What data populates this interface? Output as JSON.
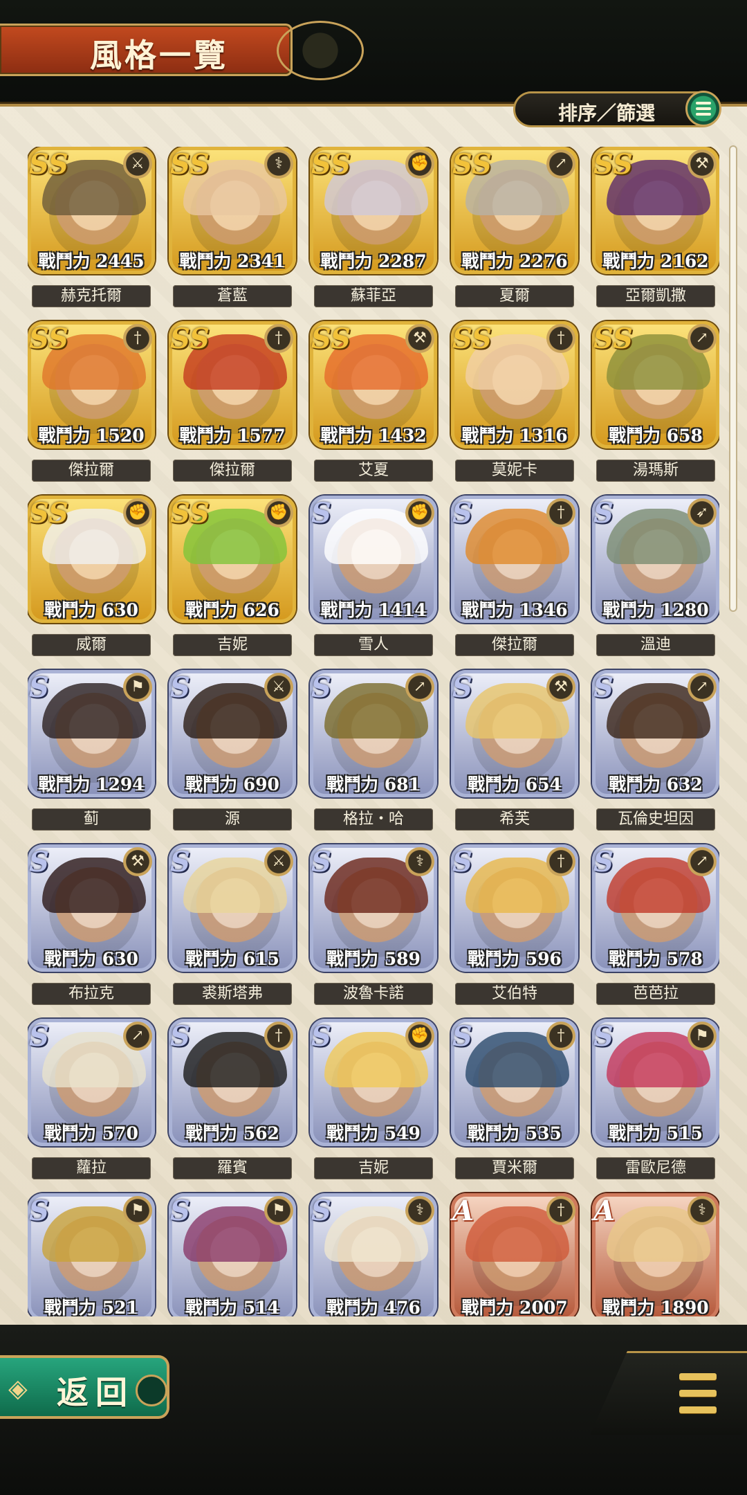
{
  "header": {
    "title": "風格一覽"
  },
  "toolbar": {
    "sort_filter_label": "排序／篩選"
  },
  "footer": {
    "back_label": "返回"
  },
  "rank_labels": {
    "ss": "SS",
    "s": "S",
    "a": "A"
  },
  "power_prefix": "戰鬥力",
  "weapon_icons": {
    "sword": "⚔",
    "axe": "⚒",
    "staff": "⚕",
    "spear": "↗",
    "bow": "➶",
    "fist": "✊",
    "dagger": "†",
    "club": "⚑"
  },
  "characters": [
    {
      "name": "赫克托爾",
      "power": "2445",
      "rank": "ss",
      "weapon": "sword"
    },
    {
      "name": "蒼藍",
      "power": "2341",
      "rank": "ss",
      "weapon": "staff"
    },
    {
      "name": "蘇菲亞",
      "power": "2287",
      "rank": "ss",
      "weapon": "fist"
    },
    {
      "name": "夏爾",
      "power": "2276",
      "rank": "ss",
      "weapon": "spear"
    },
    {
      "name": "亞爾凱撒",
      "power": "2162",
      "rank": "ss",
      "weapon": "axe"
    },
    {
      "name": "傑拉爾",
      "power": "1520",
      "rank": "ss",
      "weapon": "dagger"
    },
    {
      "name": "傑拉爾",
      "power": "1577",
      "rank": "ss",
      "weapon": "dagger"
    },
    {
      "name": "艾夏",
      "power": "1432",
      "rank": "ss",
      "weapon": "axe"
    },
    {
      "name": "莫妮卡",
      "power": "1316",
      "rank": "ss",
      "weapon": "dagger"
    },
    {
      "name": "湯瑪斯",
      "power": "658",
      "rank": "ss",
      "weapon": "spear"
    },
    {
      "name": "威爾",
      "power": "630",
      "rank": "ss",
      "weapon": "fist"
    },
    {
      "name": "吉妮",
      "power": "626",
      "rank": "ss",
      "weapon": "fist"
    },
    {
      "name": "雪人",
      "power": "1414",
      "rank": "s",
      "weapon": "fist"
    },
    {
      "name": "傑拉爾",
      "power": "1346",
      "rank": "s",
      "weapon": "dagger"
    },
    {
      "name": "溫迪",
      "power": "1280",
      "rank": "s",
      "weapon": "bow"
    },
    {
      "name": "蓟",
      "power": "1294",
      "rank": "s",
      "weapon": "club"
    },
    {
      "name": "源",
      "power": "690",
      "rank": "s",
      "weapon": "sword"
    },
    {
      "name": "格拉・哈",
      "power": "681",
      "rank": "s",
      "weapon": "spear"
    },
    {
      "name": "希芙",
      "power": "654",
      "rank": "s",
      "weapon": "axe"
    },
    {
      "name": "瓦倫史坦因",
      "power": "632",
      "rank": "s",
      "weapon": "spear"
    },
    {
      "name": "布拉克",
      "power": "630",
      "rank": "s",
      "weapon": "axe"
    },
    {
      "name": "裘斯塔弗",
      "power": "615",
      "rank": "s",
      "weapon": "sword"
    },
    {
      "name": "波魯卡諾",
      "power": "589",
      "rank": "s",
      "weapon": "staff"
    },
    {
      "name": "艾伯特",
      "power": "596",
      "rank": "s",
      "weapon": "dagger"
    },
    {
      "name": "芭芭拉",
      "power": "578",
      "rank": "s",
      "weapon": "spear"
    },
    {
      "name": "蘿拉",
      "power": "570",
      "rank": "s",
      "weapon": "spear"
    },
    {
      "name": "羅賓",
      "power": "562",
      "rank": "s",
      "weapon": "dagger"
    },
    {
      "name": "吉妮",
      "power": "549",
      "rank": "s",
      "weapon": "fist"
    },
    {
      "name": "賈米爾",
      "power": "535",
      "rank": "s",
      "weapon": "dagger"
    },
    {
      "name": "雷歐尼德",
      "power": "515",
      "rank": "s",
      "weapon": "club"
    },
    {
      "name": "",
      "power": "521",
      "rank": "s",
      "weapon": "club"
    },
    {
      "name": "",
      "power": "514",
      "rank": "s",
      "weapon": "club"
    },
    {
      "name": "",
      "power": "476",
      "rank": "s",
      "weapon": "staff"
    },
    {
      "name": "",
      "power": "2007",
      "rank": "a",
      "weapon": "dagger"
    },
    {
      "name": "",
      "power": "1890",
      "rank": "a",
      "weapon": "staff"
    }
  ],
  "colors": {
    "ss_frame": "#e0b33b",
    "s_frame": "#aab3d6",
    "a_frame": "#cf7a5c",
    "back_button": "#1f8a65",
    "title_plate": "#b03f1a",
    "name_plate": "#3b3630"
  }
}
